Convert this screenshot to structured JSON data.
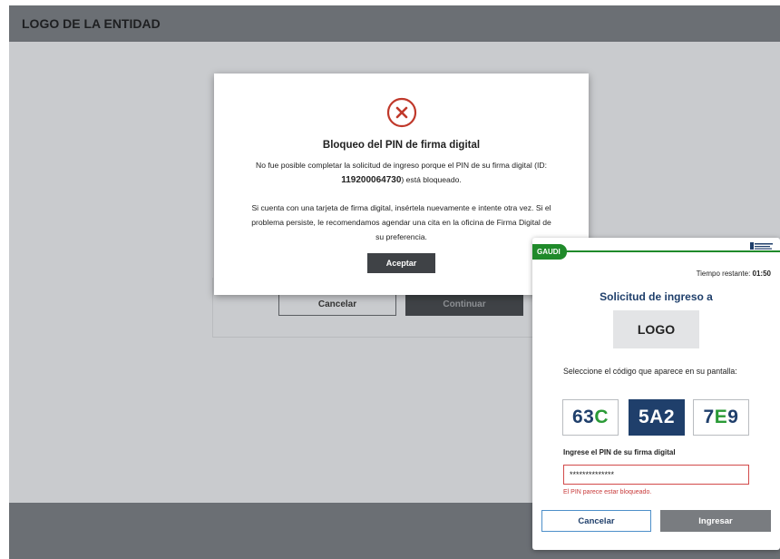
{
  "page": {
    "header_logo": "LOGO DE LA ENTIDAD",
    "background_buttons": {
      "cancel_label": "Cancelar",
      "continue_label": "Continuar"
    }
  },
  "modal": {
    "icon": "error-x-circle-icon",
    "title": "Bloqueo del PIN de firma digital",
    "text1_before": "No fue posible completar la solicitud de ingreso porque el PIN de su firma digital (ID: ",
    "text1_id": "119200064730",
    "text1_after": ") está bloqueado.",
    "text2": "Si cuenta con una tarjeta de firma digital, insértela nuevamente e intente otra vez. Si el problema persiste, le recomendamos agendar una cita en la oficina de Firma Digital de su preferencia.",
    "accept_label": "Aceptar"
  },
  "panel": {
    "brand": "GAUDI",
    "timer_label": "Tiempo restante:",
    "timer_value": "01:50",
    "title": "Solicitud de ingreso a",
    "logo": "LOGO",
    "instruction": "Seleccione el código que aparece en su pantalla:",
    "codes": [
      {
        "a": "63",
        "b": "C",
        "c": ""
      },
      {
        "a": "5A2",
        "b": "",
        "c": ""
      },
      {
        "a": "7",
        "b": "E",
        "c": "9"
      }
    ],
    "pin_label": "Ingrese el PIN de su firma digital",
    "pin_value": "**************",
    "pin_error": "El PIN parece estar bloqueado.",
    "cancel_label": "Cancelar",
    "submit_label": "Ingresar"
  },
  "colors": {
    "gaudi_green": "#1f8a2a",
    "navy": "#1f3f6b",
    "error_red": "#c83a3a"
  }
}
